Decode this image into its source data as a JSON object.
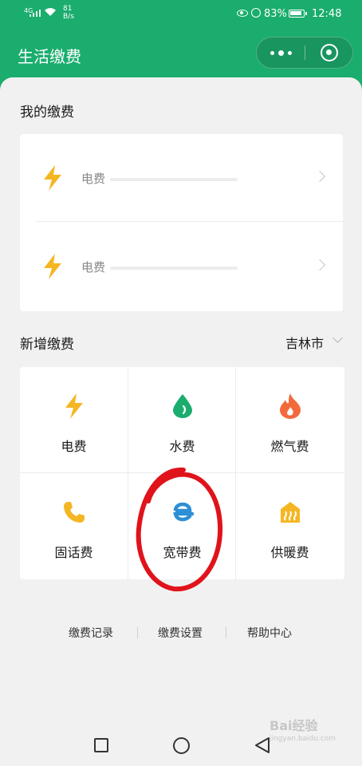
{
  "status_bar": {
    "signal": "4G",
    "net_speed_value": "81",
    "net_speed_unit": "B/s",
    "battery": "83%",
    "time": "12:48"
  },
  "header": {
    "title": "生活缴费",
    "capsule_more_icon": "more-dots-icon",
    "capsule_close_icon": "target-close-icon",
    "brand_color": "#1aad6e"
  },
  "my_bills": {
    "title": "我的缴费",
    "items": [
      {
        "label": "电费",
        "icon": "lightning-icon"
      },
      {
        "label": "电费",
        "icon": "lightning-icon"
      }
    ]
  },
  "new_bill": {
    "title": "新增缴费",
    "city": "吉林市",
    "items": [
      {
        "label": "电费",
        "icon": "lightning-icon",
        "color": "#f5b623"
      },
      {
        "label": "水费",
        "icon": "water-drop-icon",
        "color": "#1aad6e"
      },
      {
        "label": "燃气费",
        "icon": "flame-icon",
        "color": "#f26a3c"
      },
      {
        "label": "固话费",
        "icon": "phone-icon",
        "color": "#f5b623"
      },
      {
        "label": "宽带费",
        "icon": "broadband-e-icon",
        "color": "#2d8fd5"
      },
      {
        "label": "供暖费",
        "icon": "heater-icon",
        "color": "#f5b623"
      }
    ]
  },
  "footer_links": [
    "缴费记录",
    "缴费设置",
    "帮助中心"
  ],
  "nav": {
    "square": "recent-apps-icon",
    "circle": "home-icon",
    "triangle": "back-icon"
  },
  "watermark": {
    "line1": "Bai",
    "line2": "经验",
    "line3": "jingyan.baidu.com"
  },
  "annotation_color": "#e0131b"
}
